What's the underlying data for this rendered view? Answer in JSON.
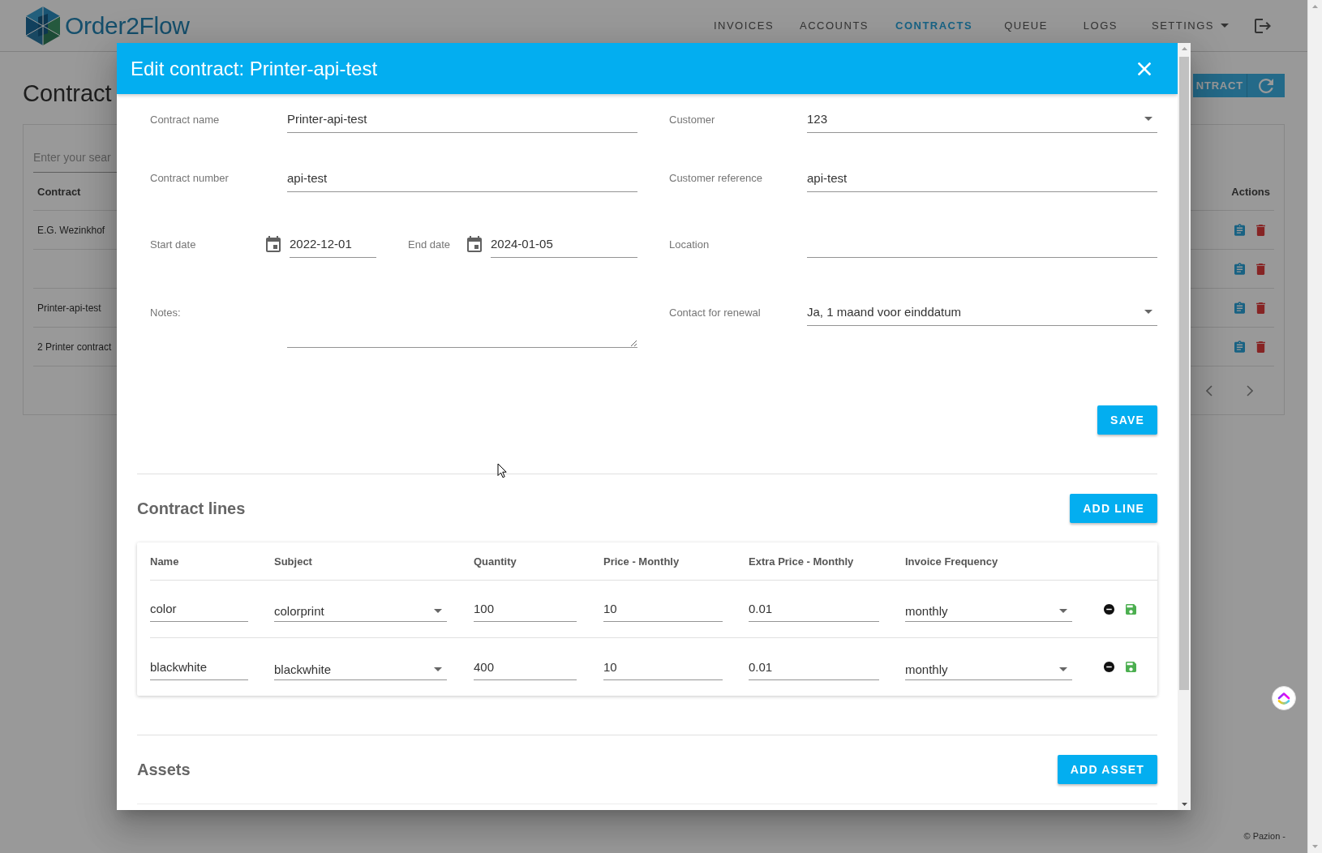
{
  "header": {
    "logo": "Order2Flow",
    "nav": [
      {
        "label": "INVOICES",
        "selected": false,
        "kind": "link"
      },
      {
        "label": "ACCOUNTS",
        "selected": false,
        "kind": "link"
      },
      {
        "label": "CONTRACTS",
        "selected": true,
        "kind": "link"
      },
      {
        "label": "QUEUE",
        "selected": false,
        "kind": "link"
      },
      {
        "label": "LOGS",
        "selected": false,
        "kind": "link"
      },
      {
        "label": "SETTINGS",
        "selected": false,
        "kind": "menu"
      }
    ]
  },
  "page": {
    "title": "Contract",
    "toolbar_button": "NTRACT",
    "search": {
      "placeholder": "Enter your sear"
    },
    "table": {
      "columns": [
        "Contract",
        "Actions"
      ],
      "rows": [
        {
          "contract": "E.G. Wezinkhof"
        },
        {},
        {
          "contract": "Printer-api-test"
        },
        {
          "contract": "2 Printer contract"
        }
      ]
    }
  },
  "dialog": {
    "title": "Edit contract: Printer-api-test",
    "left_fields": [
      {
        "kind": "text",
        "label": "Contract name",
        "value": "Printer-api-test"
      },
      {
        "kind": "text",
        "label": "Contract number",
        "value": "api-test"
      },
      {
        "kind": "dates",
        "items": [
          {
            "label": "Start date",
            "value": "2022-12-01"
          },
          {
            "label": "End date",
            "value": "2024-01-05"
          }
        ]
      },
      {
        "kind": "textarea",
        "label": "Notes:"
      }
    ],
    "right_fields": [
      {
        "kind": "select",
        "label": "Customer",
        "value": "123"
      },
      {
        "kind": "text",
        "label": "Customer reference",
        "value": "api-test"
      },
      {
        "kind": "text",
        "label": "Location"
      },
      {
        "kind": "select",
        "label": "Contact for renewal",
        "value": "Ja, 1 maand voor einddatum"
      }
    ],
    "save_button": "SAVE",
    "contract_lines": {
      "title": "Contract lines",
      "add_button": "ADD LINE",
      "columns": [
        {
          "label": "Name",
          "kind": "text"
        },
        {
          "label": "Subject",
          "kind": "select"
        },
        {
          "label": "Quantity",
          "kind": "text"
        },
        {
          "label": "Price - Monthly",
          "kind": "text"
        },
        {
          "label": "Extra Price - Monthly",
          "kind": "text"
        },
        {
          "label": "Invoice Frequency",
          "kind": "select"
        }
      ],
      "rows": [
        {
          "cells": [
            "color",
            "colorprint",
            "100",
            "10",
            "0.01",
            "monthly"
          ]
        },
        {
          "cells": [
            "blackwhite",
            "blackwhite",
            "400",
            "10",
            "0.01",
            "monthly"
          ]
        }
      ]
    },
    "assets": {
      "title": "Assets",
      "add_button": "ADD ASSET"
    }
  },
  "footer": {
    "text": "© Pazion -"
  }
}
